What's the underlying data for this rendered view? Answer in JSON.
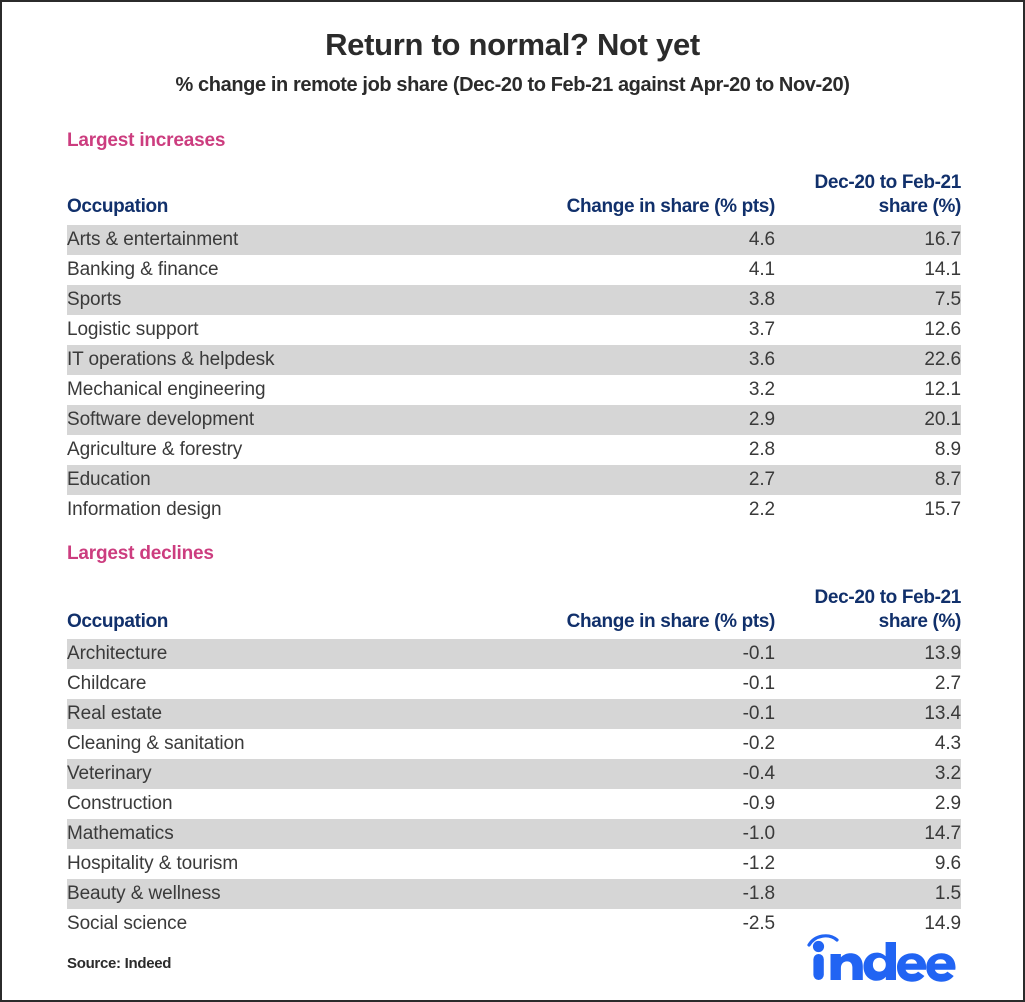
{
  "header": {
    "title": "Return to normal? Not yet",
    "subtitle": "% change in remote job share (Dec-20 to Feb-21 against Apr-20 to Nov-20)"
  },
  "colors": {
    "section_heading": "#cc3d7f",
    "table_header": "#11306b",
    "row_stripe": "#d6d6d6",
    "title": "#2b2b2b",
    "logo_blue": "#2164f3"
  },
  "sections": [
    {
      "heading": "Largest increases",
      "columns": {
        "occupation": "Occupation",
        "change": "Change in share (% pts)",
        "share_line1": "Dec-20 to Feb-21",
        "share_line2": "share (%)"
      },
      "rows": [
        {
          "occupation": "Arts & entertainment",
          "change": "4.6",
          "share": "16.7"
        },
        {
          "occupation": "Banking & finance",
          "change": "4.1",
          "share": "14.1"
        },
        {
          "occupation": "Sports",
          "change": "3.8",
          "share": "7.5"
        },
        {
          "occupation": "Logistic support",
          "change": "3.7",
          "share": "12.6"
        },
        {
          "occupation": "IT operations & helpdesk",
          "change": "3.6",
          "share": "22.6"
        },
        {
          "occupation": "Mechanical engineering",
          "change": "3.2",
          "share": "12.1"
        },
        {
          "occupation": "Software development",
          "change": "2.9",
          "share": "20.1"
        },
        {
          "occupation": "Agriculture & forestry",
          "change": "2.8",
          "share": "8.9"
        },
        {
          "occupation": "Education",
          "change": "2.7",
          "share": "8.7"
        },
        {
          "occupation": "Information design",
          "change": "2.2",
          "share": "15.7"
        }
      ]
    },
    {
      "heading": "Largest declines",
      "columns": {
        "occupation": "Occupation",
        "change": "Change in share (% pts)",
        "share_line1": "Dec-20 to Feb-21",
        "share_line2": "share (%)"
      },
      "rows": [
        {
          "occupation": "Architecture",
          "change": "-0.1",
          "share": "13.9"
        },
        {
          "occupation": "Childcare",
          "change": "-0.1",
          "share": "2.7"
        },
        {
          "occupation": "Real estate",
          "change": "-0.1",
          "share": "13.4"
        },
        {
          "occupation": "Cleaning & sanitation",
          "change": "-0.2",
          "share": "4.3"
        },
        {
          "occupation": "Veterinary",
          "change": "-0.4",
          "share": "3.2"
        },
        {
          "occupation": "Construction",
          "change": "-0.9",
          "share": "2.9"
        },
        {
          "occupation": "Mathematics",
          "change": "-1.0",
          "share": "14.7"
        },
        {
          "occupation": "Hospitality & tourism",
          "change": "-1.2",
          "share": "9.6"
        },
        {
          "occupation": "Beauty & wellness",
          "change": "-1.8",
          "share": "1.5"
        },
        {
          "occupation": "Social science",
          "change": "-2.5",
          "share": "14.9"
        }
      ]
    }
  ],
  "footer": {
    "source": "Source: Indeed",
    "logo_text": "indeed"
  },
  "chart_data": {
    "type": "table",
    "title": "Return to normal? Not yet",
    "subtitle": "% change in remote job share (Dec-20 to Feb-21 against Apr-20 to Nov-20)",
    "columns": [
      "Occupation",
      "Change in share (% pts)",
      "Dec-20 to Feb-21 share (%)"
    ],
    "tables": [
      {
        "name": "Largest increases",
        "categories": [
          "Arts & entertainment",
          "Banking & finance",
          "Sports",
          "Logistic support",
          "IT operations & helpdesk",
          "Mechanical engineering",
          "Software development",
          "Agriculture & forestry",
          "Education",
          "Information design"
        ],
        "series": [
          {
            "name": "Change in share (% pts)",
            "values": [
              4.6,
              4.1,
              3.8,
              3.7,
              3.6,
              3.2,
              2.9,
              2.8,
              2.7,
              2.2
            ]
          },
          {
            "name": "Dec-20 to Feb-21 share (%)",
            "values": [
              16.7,
              14.1,
              7.5,
              12.6,
              22.6,
              12.1,
              20.1,
              8.9,
              8.7,
              15.7
            ]
          }
        ]
      },
      {
        "name": "Largest declines",
        "categories": [
          "Architecture",
          "Childcare",
          "Real estate",
          "Cleaning & sanitation",
          "Veterinary",
          "Construction",
          "Mathematics",
          "Hospitality & tourism",
          "Beauty & wellness",
          "Social science"
        ],
        "series": [
          {
            "name": "Change in share (% pts)",
            "values": [
              -0.1,
              -0.1,
              -0.1,
              -0.2,
              -0.4,
              -0.9,
              -1.0,
              -1.2,
              -1.8,
              -2.5
            ]
          },
          {
            "name": "Dec-20 to Feb-21 share (%)",
            "values": [
              13.9,
              2.7,
              13.4,
              4.3,
              3.2,
              2.9,
              14.7,
              9.6,
              1.5,
              14.9
            ]
          }
        ]
      }
    ],
    "source": "Source: Indeed"
  }
}
